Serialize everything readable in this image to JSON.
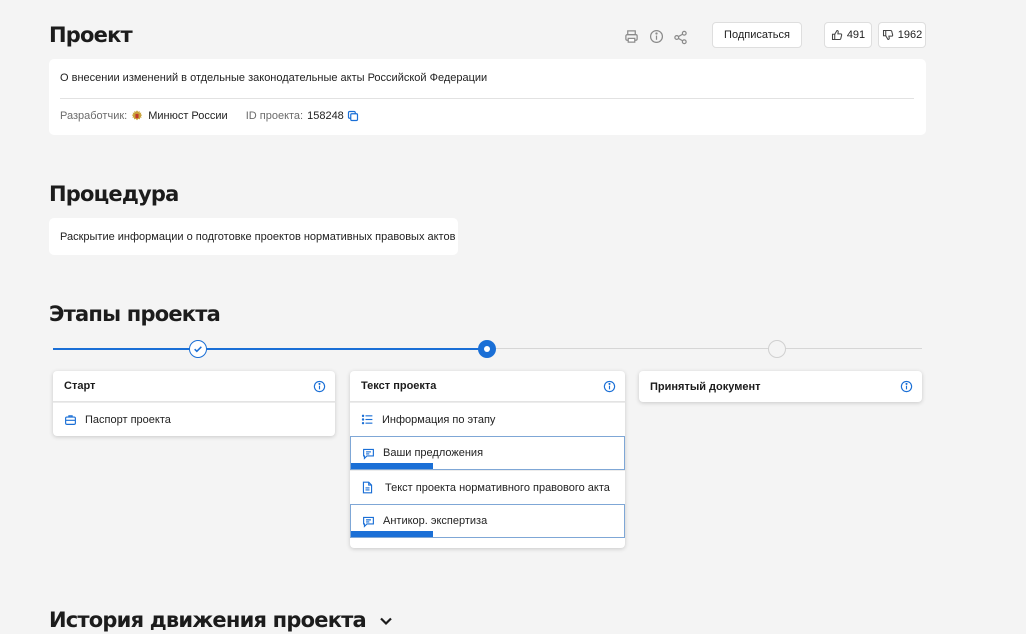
{
  "project": {
    "title": "Проект",
    "description": "О внесении изменений в отдельные законодательные акты Российской Федерации",
    "developer_label": "Разработчик:",
    "developer_value": "Минюст России",
    "id_label": "ID проекта:",
    "id_value": "158248",
    "subscribe_label": "Подписаться",
    "likes": "491",
    "dislikes": "1962"
  },
  "procedure": {
    "title": "Процедура",
    "text": "Раскрытие информации о подготовке проектов нормативных правовых актов"
  },
  "stages": {
    "title": "Этапы проекта",
    "items": [
      {
        "label": "Старт",
        "state": "completed",
        "rows": [
          {
            "label": "Паспорт проекта",
            "icon": "briefcase-icon"
          }
        ]
      },
      {
        "label": "Текст проекта",
        "state": "current",
        "rows": [
          {
            "label": "Информация по этапу",
            "icon": "list-icon"
          },
          {
            "label": "Ваши предложения",
            "icon": "comment-icon",
            "progress": 0.3
          },
          {
            "label": "Текст проекта нормативного правового акта",
            "icon": "document-icon"
          },
          {
            "label": "Антикор. экспертиза",
            "icon": "comment-icon",
            "progress": 0.3
          }
        ]
      },
      {
        "label": "Принятый документ",
        "state": "pending",
        "rows": []
      }
    ]
  },
  "history": {
    "title": "История движения проекта"
  },
  "colors": {
    "accent": "#1a6fd6",
    "background": "#f4f4f4",
    "card": "#ffffff"
  }
}
